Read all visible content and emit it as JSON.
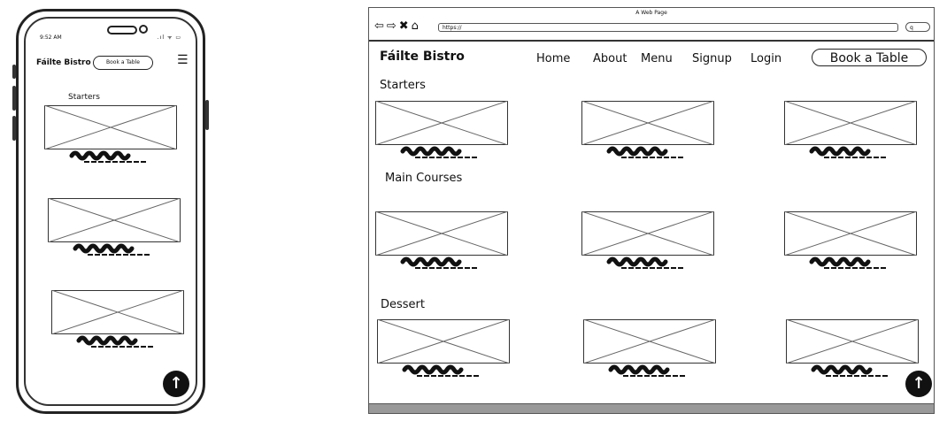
{
  "phone": {
    "status_time": "9:52 AM",
    "status_icons": ".ıl ᯤ ▭",
    "brand": "Fáilte Bistro",
    "book_button": "Book a Table",
    "menu_icon": "hamburger-icon",
    "section_label": "Starters",
    "back_to_top_icon": "arrow-up-icon"
  },
  "browser": {
    "window_title": "A Web Page",
    "nav_icons": "⇦⇨✖⌂",
    "url": "https://",
    "search_icon": "q",
    "brand": "Fáilte Bistro",
    "nav": {
      "home": "Home",
      "about": "About",
      "menu": "Menu",
      "signup": "Signup",
      "login": "Login"
    },
    "book_button": "Book a Table",
    "sections": {
      "starters": "Starters",
      "main_courses": "Main Courses",
      "dessert": "Dessert"
    },
    "back_to_top_icon": "arrow-up-icon"
  }
}
